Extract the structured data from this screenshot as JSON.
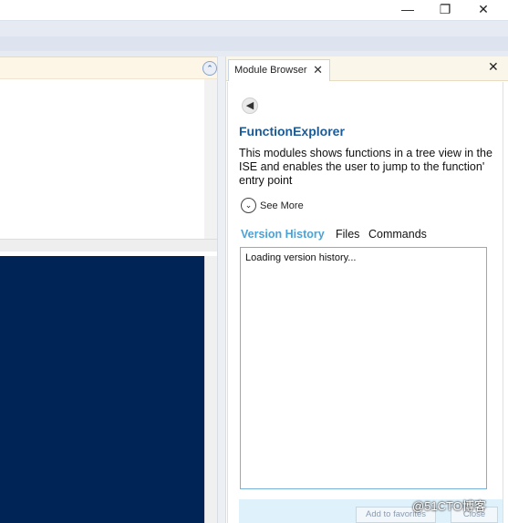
{
  "window": {
    "minimize_glyph": "—",
    "restore_glyph": "❐",
    "close_glyph": "✕"
  },
  "module_browser": {
    "tab_label": "Module Browser",
    "tab_close_glyph": "✕",
    "pane_close_glyph": "✕",
    "back_glyph": "◀",
    "module_title": "FunctionExplorer",
    "description": "This modules shows functions in a tree view in the ISE and enables the user to jump to the function' entry point",
    "see_more_glyph": "⌄",
    "see_more_label": "See More",
    "tabs": [
      {
        "label": "Version History",
        "active": true
      },
      {
        "label": "Files",
        "active": false
      },
      {
        "label": "Commands",
        "active": false
      }
    ],
    "history_text": "Loading version history...",
    "footer_buttons": [
      {
        "label": "Add to favorites"
      },
      {
        "label": "Close"
      }
    ]
  },
  "editor": {
    "collapse_glyph": "⌃"
  },
  "watermark": "@51CTO博客",
  "colors": {
    "console_bg": "#012456",
    "accent_title": "#1a5b96",
    "active_tab": "#4aa3d8",
    "history_border": "#79b1dd"
  },
  "icons": [
    "minimize-icon",
    "restore-icon",
    "close-icon",
    "back-arrow-icon",
    "chevron-down-icon",
    "collapse-up-icon"
  ]
}
